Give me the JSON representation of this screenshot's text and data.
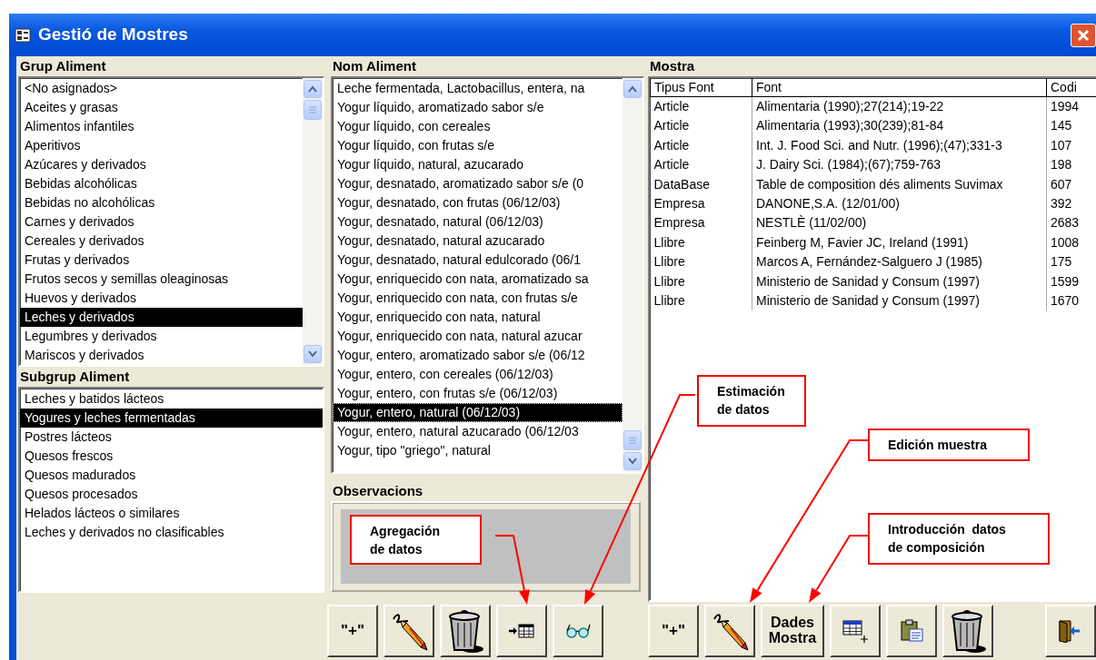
{
  "window": {
    "title": "Gestió de Mostres"
  },
  "groups": {
    "label": "Grup Aliment",
    "items": [
      {
        "text": "<No asignados>",
        "selected": false
      },
      {
        "text": "Aceites y grasas",
        "selected": false
      },
      {
        "text": "Alimentos infantiles",
        "selected": false
      },
      {
        "text": "Aperitivos",
        "selected": false
      },
      {
        "text": "Azúcares y derivados",
        "selected": false
      },
      {
        "text": "Bebidas alcohólicas",
        "selected": false
      },
      {
        "text": "Bebidas no alcohólicas",
        "selected": false
      },
      {
        "text": "Carnes y derivados",
        "selected": false
      },
      {
        "text": "Cereales y derivados",
        "selected": false
      },
      {
        "text": "Frutas y derivados",
        "selected": false
      },
      {
        "text": "Frutos secos y semillas oleaginosas",
        "selected": false
      },
      {
        "text": "Huevos y derivados",
        "selected": false
      },
      {
        "text": "Leches y derivados",
        "selected": true
      },
      {
        "text": "Legumbres y derivados",
        "selected": false
      },
      {
        "text": "Mariscos y derivados",
        "selected": false
      }
    ]
  },
  "subgroups": {
    "label": "Subgrup Aliment",
    "items": [
      {
        "text": "Leches y batidos lácteos",
        "selected": false
      },
      {
        "text": "Yogures y leches fermentadas",
        "selected": true
      },
      {
        "text": "Postres lácteos",
        "selected": false
      },
      {
        "text": "Quesos frescos",
        "selected": false
      },
      {
        "text": "Quesos madurados",
        "selected": false
      },
      {
        "text": "Quesos procesados",
        "selected": false
      },
      {
        "text": "Helados lácteos o similares",
        "selected": false
      },
      {
        "text": "Leches y derivados no clasificables",
        "selected": false
      }
    ]
  },
  "foods": {
    "label": "Nom Aliment",
    "items": [
      {
        "text": "Leche fermentada, Lactobacillus, entera, na",
        "selected": false
      },
      {
        "text": "Yogur líquido, aromatizado sabor s/e",
        "selected": false
      },
      {
        "text": "Yogur líquido, con cereales",
        "selected": false
      },
      {
        "text": "Yogur líquido, con frutas s/e",
        "selected": false
      },
      {
        "text": "Yogur líquido, natural, azucarado",
        "selected": false
      },
      {
        "text": "Yogur, desnatado, aromatizado sabor s/e (0",
        "selected": false
      },
      {
        "text": "Yogur, desnatado, con frutas (06/12/03)",
        "selected": false
      },
      {
        "text": "Yogur, desnatado, natural (06/12/03)",
        "selected": false
      },
      {
        "text": "Yogur, desnatado, natural azucarado",
        "selected": false
      },
      {
        "text": "Yogur, desnatado, natural edulcorado (06/1",
        "selected": false
      },
      {
        "text": "Yogur, enriquecido con nata, aromatizado sa",
        "selected": false
      },
      {
        "text": "Yogur, enriquecido con nata, con frutas s/e",
        "selected": false
      },
      {
        "text": "Yogur, enriquecido con nata, natural",
        "selected": false
      },
      {
        "text": "Yogur, enriquecido con nata, natural azucar",
        "selected": false
      },
      {
        "text": "Yogur, entero, aromatizado sabor s/e (06/12",
        "selected": false
      },
      {
        "text": "Yogur, entero, con cereales (06/12/03)",
        "selected": false
      },
      {
        "text": "Yogur, entero, con frutas s/e (06/12/03)",
        "selected": false
      },
      {
        "text": "Yogur, entero, natural (06/12/03)",
        "selected": true
      },
      {
        "text": "Yogur, entero, natural azucarado (06/12/03",
        "selected": false
      },
      {
        "text": "Yogur, tipo \"griego\", natural",
        "selected": false
      }
    ]
  },
  "observations": {
    "label": "Observacions"
  },
  "samples": {
    "label": "Mostra",
    "columns": [
      "Tipus Font",
      "Font",
      "Codi"
    ],
    "rows": [
      [
        "Article",
        "Alimentaria (1990);27(214);19-22",
        "1994"
      ],
      [
        "Article",
        "Alimentaria (1993);30(239);81-84",
        "145"
      ],
      [
        "Article",
        "Int. J. Food Sci. and  Nutr. (1996);(47);331-3",
        "107"
      ],
      [
        "Article",
        "J. Dairy Sci. (1984);(67);759-763",
        "198"
      ],
      [
        "DataBase",
        "Table de composition dés aliments Suvimax",
        "607"
      ],
      [
        "Empresa",
        "DANONE,S.A. (12/01/00)",
        "392"
      ],
      [
        "Empresa",
        "NESTLÈ (11/02/00)",
        "2683"
      ],
      [
        "Llibre",
        "Feinberg M, Favier JC, Ireland (1991)",
        "1008"
      ],
      [
        "Llibre",
        "Marcos A, Fernández-Salguero J (1985)",
        "175"
      ],
      [
        "Llibre",
        "Ministerio de Sanidad y Consum (1997)",
        "1599"
      ],
      [
        "Llibre",
        "Ministerio de Sanidad y Consum (1997)",
        "1670"
      ]
    ]
  },
  "food_buttons": [
    {
      "kind": "add",
      "label": "\"+\""
    },
    {
      "kind": "edit"
    },
    {
      "kind": "delete"
    },
    {
      "kind": "aggregate"
    },
    {
      "kind": "estimate"
    }
  ],
  "sample_buttons": [
    {
      "kind": "add",
      "label": "\"+\""
    },
    {
      "kind": "edit"
    },
    {
      "kind": "text",
      "label": "Dades\nMostra"
    },
    {
      "kind": "new-row"
    },
    {
      "kind": "paste"
    },
    {
      "kind": "delete"
    },
    {
      "kind": "exit"
    }
  ],
  "callouts": [
    {
      "text": "Agregación\nde datos"
    },
    {
      "text": "Estimación\nde datos"
    },
    {
      "text": "Edición muestra"
    },
    {
      "text": "Introducción  datos\nde composición"
    }
  ]
}
